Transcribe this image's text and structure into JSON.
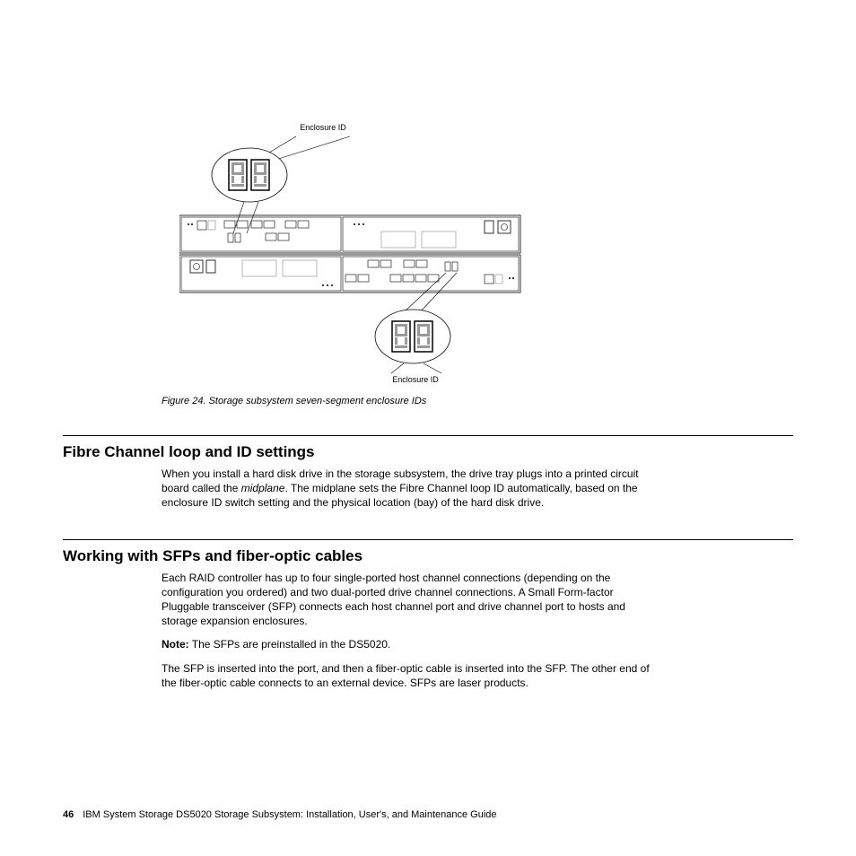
{
  "figure": {
    "label_top": "Enclosure ID",
    "label_bottom": "Enclosure ID",
    "caption": "Figure 24. Storage subsystem seven-segment enclosure IDs"
  },
  "sections": {
    "fibre": {
      "heading": "Fibre Channel loop and ID settings",
      "p1a": "When you install a hard disk drive in the storage subsystem, the drive tray plugs into a printed circuit board called the ",
      "p1_em": "midplane",
      "p1b": ". The midplane sets the Fibre Channel loop ID automatically, based on the enclosure ID switch setting and the physical location (bay) of the hard disk drive."
    },
    "sfp": {
      "heading": "Working with SFPs and fiber-optic cables",
      "p1": "Each RAID controller has up to four single-ported host channel connections (depending on the configuration you ordered) and two dual-ported drive channel connections. A Small Form-factor Pluggable transceiver (SFP) connects each host channel port and drive channel port to hosts and storage expansion enclosures.",
      "note_label": "Note:",
      "note_text": "  The SFPs are preinstalled in the DS5020.",
      "p2": "The SFP is inserted into the port, and then a fiber-optic cable is inserted into the SFP. The other end of the fiber-optic cable connects to an external device. SFPs are laser products."
    }
  },
  "footer": {
    "page": "46",
    "title": "IBM System Storage DS5020 Storage Subsystem:  Installation, User's, and Maintenance Guide"
  }
}
